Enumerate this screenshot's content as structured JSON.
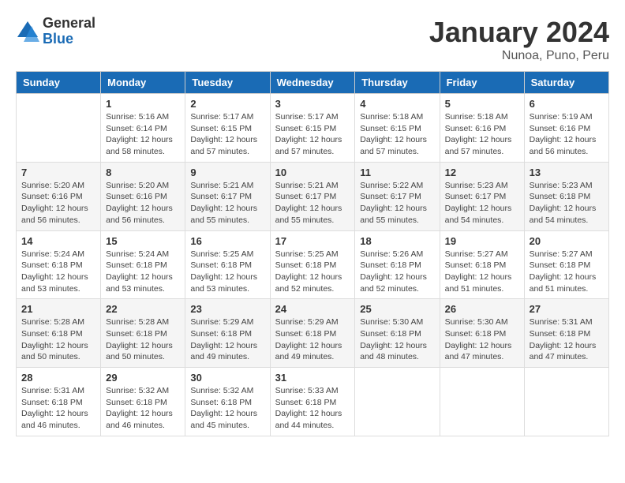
{
  "logo": {
    "general": "General",
    "blue": "Blue",
    "icon_color": "#1a6bb5"
  },
  "title": "January 2024",
  "subtitle": "Nunoa, Puno, Peru",
  "days_of_week": [
    "Sunday",
    "Monday",
    "Tuesday",
    "Wednesday",
    "Thursday",
    "Friday",
    "Saturday"
  ],
  "weeks": [
    [
      {
        "day": "",
        "info": ""
      },
      {
        "day": "1",
        "info": "Sunrise: 5:16 AM\nSunset: 6:14 PM\nDaylight: 12 hours\nand 58 minutes."
      },
      {
        "day": "2",
        "info": "Sunrise: 5:17 AM\nSunset: 6:15 PM\nDaylight: 12 hours\nand 57 minutes."
      },
      {
        "day": "3",
        "info": "Sunrise: 5:17 AM\nSunset: 6:15 PM\nDaylight: 12 hours\nand 57 minutes."
      },
      {
        "day": "4",
        "info": "Sunrise: 5:18 AM\nSunset: 6:15 PM\nDaylight: 12 hours\nand 57 minutes."
      },
      {
        "day": "5",
        "info": "Sunrise: 5:18 AM\nSunset: 6:16 PM\nDaylight: 12 hours\nand 57 minutes."
      },
      {
        "day": "6",
        "info": "Sunrise: 5:19 AM\nSunset: 6:16 PM\nDaylight: 12 hours\nand 56 minutes."
      }
    ],
    [
      {
        "day": "7",
        "info": "Sunrise: 5:20 AM\nSunset: 6:16 PM\nDaylight: 12 hours\nand 56 minutes."
      },
      {
        "day": "8",
        "info": "Sunrise: 5:20 AM\nSunset: 6:16 PM\nDaylight: 12 hours\nand 56 minutes."
      },
      {
        "day": "9",
        "info": "Sunrise: 5:21 AM\nSunset: 6:17 PM\nDaylight: 12 hours\nand 55 minutes."
      },
      {
        "day": "10",
        "info": "Sunrise: 5:21 AM\nSunset: 6:17 PM\nDaylight: 12 hours\nand 55 minutes."
      },
      {
        "day": "11",
        "info": "Sunrise: 5:22 AM\nSunset: 6:17 PM\nDaylight: 12 hours\nand 55 minutes."
      },
      {
        "day": "12",
        "info": "Sunrise: 5:23 AM\nSunset: 6:17 PM\nDaylight: 12 hours\nand 54 minutes."
      },
      {
        "day": "13",
        "info": "Sunrise: 5:23 AM\nSunset: 6:18 PM\nDaylight: 12 hours\nand 54 minutes."
      }
    ],
    [
      {
        "day": "14",
        "info": "Sunrise: 5:24 AM\nSunset: 6:18 PM\nDaylight: 12 hours\nand 53 minutes."
      },
      {
        "day": "15",
        "info": "Sunrise: 5:24 AM\nSunset: 6:18 PM\nDaylight: 12 hours\nand 53 minutes."
      },
      {
        "day": "16",
        "info": "Sunrise: 5:25 AM\nSunset: 6:18 PM\nDaylight: 12 hours\nand 53 minutes."
      },
      {
        "day": "17",
        "info": "Sunrise: 5:25 AM\nSunset: 6:18 PM\nDaylight: 12 hours\nand 52 minutes."
      },
      {
        "day": "18",
        "info": "Sunrise: 5:26 AM\nSunset: 6:18 PM\nDaylight: 12 hours\nand 52 minutes."
      },
      {
        "day": "19",
        "info": "Sunrise: 5:27 AM\nSunset: 6:18 PM\nDaylight: 12 hours\nand 51 minutes."
      },
      {
        "day": "20",
        "info": "Sunrise: 5:27 AM\nSunset: 6:18 PM\nDaylight: 12 hours\nand 51 minutes."
      }
    ],
    [
      {
        "day": "21",
        "info": "Sunrise: 5:28 AM\nSunset: 6:18 PM\nDaylight: 12 hours\nand 50 minutes."
      },
      {
        "day": "22",
        "info": "Sunrise: 5:28 AM\nSunset: 6:18 PM\nDaylight: 12 hours\nand 50 minutes."
      },
      {
        "day": "23",
        "info": "Sunrise: 5:29 AM\nSunset: 6:18 PM\nDaylight: 12 hours\nand 49 minutes."
      },
      {
        "day": "24",
        "info": "Sunrise: 5:29 AM\nSunset: 6:18 PM\nDaylight: 12 hours\nand 49 minutes."
      },
      {
        "day": "25",
        "info": "Sunrise: 5:30 AM\nSunset: 6:18 PM\nDaylight: 12 hours\nand 48 minutes."
      },
      {
        "day": "26",
        "info": "Sunrise: 5:30 AM\nSunset: 6:18 PM\nDaylight: 12 hours\nand 47 minutes."
      },
      {
        "day": "27",
        "info": "Sunrise: 5:31 AM\nSunset: 6:18 PM\nDaylight: 12 hours\nand 47 minutes."
      }
    ],
    [
      {
        "day": "28",
        "info": "Sunrise: 5:31 AM\nSunset: 6:18 PM\nDaylight: 12 hours\nand 46 minutes."
      },
      {
        "day": "29",
        "info": "Sunrise: 5:32 AM\nSunset: 6:18 PM\nDaylight: 12 hours\nand 46 minutes."
      },
      {
        "day": "30",
        "info": "Sunrise: 5:32 AM\nSunset: 6:18 PM\nDaylight: 12 hours\nand 45 minutes."
      },
      {
        "day": "31",
        "info": "Sunrise: 5:33 AM\nSunset: 6:18 PM\nDaylight: 12 hours\nand 44 minutes."
      },
      {
        "day": "",
        "info": ""
      },
      {
        "day": "",
        "info": ""
      },
      {
        "day": "",
        "info": ""
      }
    ]
  ]
}
